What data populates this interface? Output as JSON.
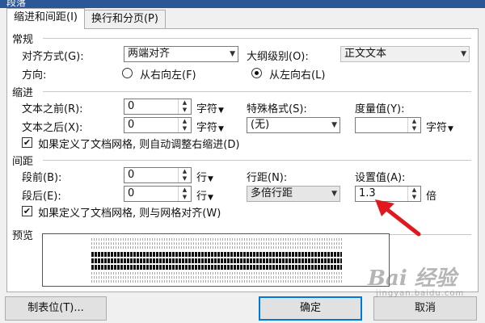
{
  "window": {
    "title": "段落"
  },
  "tabs": [
    {
      "label": "缩进和间距(I)",
      "active": true
    },
    {
      "label": "换行和分页(P)",
      "active": false
    }
  ],
  "general": {
    "section_label": "常规",
    "alignment_label": "对齐方式(G):",
    "alignment_value": "两端对齐",
    "outline_label": "大纲级别(O):",
    "outline_value": "正文文本",
    "direction_label": "方向:",
    "direction_options": [
      {
        "label": "从右向左(F)",
        "selected": false
      },
      {
        "label": "从左向右(L)",
        "selected": true
      }
    ]
  },
  "indent": {
    "section_label": "缩进",
    "before_label": "文本之前(R):",
    "before_value": "0",
    "after_label": "文本之后(X):",
    "after_value": "0",
    "unit": "字符",
    "special_label": "特殊格式(S):",
    "special_value": "(无)",
    "measure_label": "度量值(Y):",
    "measure_value": "",
    "grid_checkbox_label": "如果定义了文档网格, 则自动调整右缩进(D)",
    "grid_checkbox_checked": true
  },
  "spacing": {
    "section_label": "间距",
    "before_label": "段前(B):",
    "before_value": "0",
    "after_label": "段后(E):",
    "after_value": "0",
    "unit": "行",
    "line_spacing_label": "行距(N):",
    "line_spacing_value": "多倍行距",
    "setting_label": "设置值(A):",
    "setting_value": "1.3",
    "setting_unit": "倍",
    "grid_checkbox_label": "如果定义了文档网格, 则与网格对齐(W)",
    "grid_checkbox_checked": true
  },
  "preview": {
    "section_label": "预览"
  },
  "buttons": {
    "tabs_label": "制表位(T)...",
    "ok_label": "确定",
    "cancel_label": "取消"
  },
  "watermark": {
    "text": "Bai 经验",
    "sub": "jingyan.baidu.com"
  },
  "colors": {
    "accent": "#0078d7",
    "annotation_arrow": "#e0191f",
    "title_bar": "#2b5797"
  }
}
